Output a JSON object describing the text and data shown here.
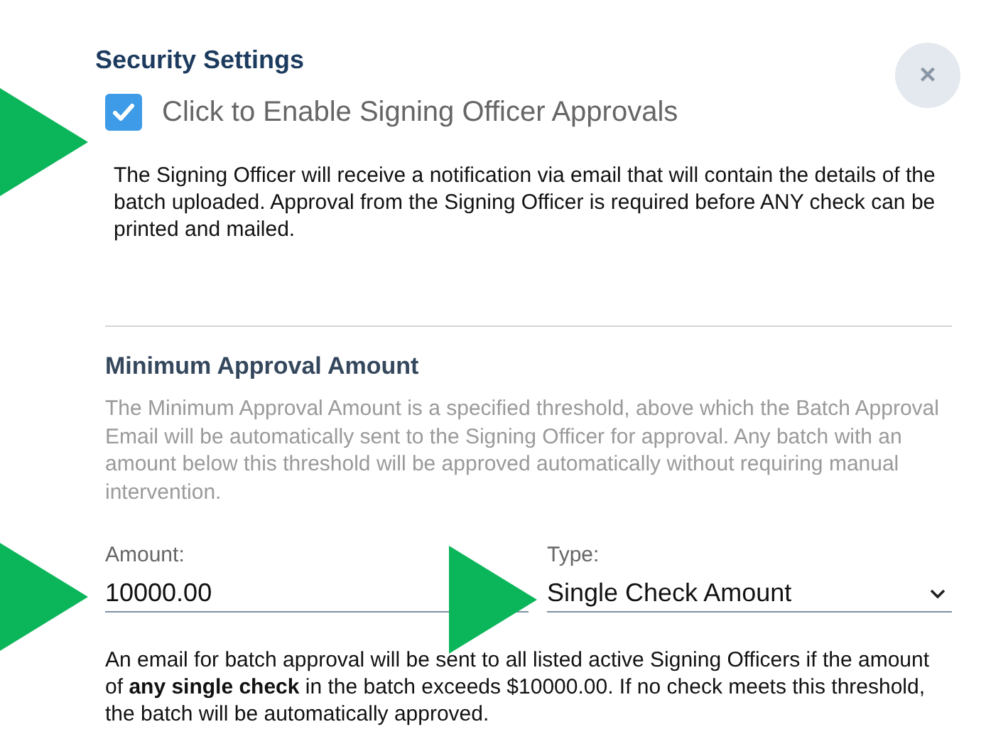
{
  "title": "Security Settings",
  "close_button": {
    "label": "×"
  },
  "enable_checkbox": {
    "label": "Click to Enable Signing Officer Approvals",
    "checked": true
  },
  "enable_description": "The Signing Officer will receive a notification via email that will contain the details of the batch uploaded. Approval from the Signing Officer is required before ANY check can be printed and mailed.",
  "minimum_section": {
    "heading": "Minimum Approval Amount",
    "description": "The Minimum Approval Amount is a specified threshold, above which the Batch Approval Email will be automatically sent to the Signing Officer for approval. Any batch with an amount below this threshold will be approved automatically without requiring manual intervention."
  },
  "amount_field": {
    "label": "Amount:",
    "value": "10000.00"
  },
  "type_field": {
    "label": "Type:",
    "value": "Single Check Amount"
  },
  "summary": "An email for batch approval will be sent to all listed active Signing Officers if the amount of **any single check** in the batch exceeds $10000.00. If no check meets this threshold, the batch will be automatically approved.",
  "annotations": [
    {
      "kind": "pointer-arrow"
    },
    {
      "kind": "pointer-arrow"
    },
    {
      "kind": "pointer-arrow"
    }
  ]
}
